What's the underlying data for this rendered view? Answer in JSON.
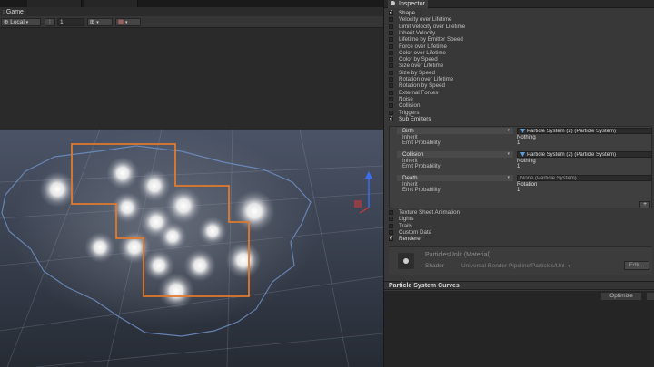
{
  "game_tab": {
    "label": "Game"
  },
  "toolbar": {
    "space_label": "Local",
    "number_value": "1"
  },
  "inspector": {
    "tab_label": "Inspector",
    "modules": [
      {
        "label": "Shape",
        "checked": true
      },
      {
        "label": "Velocity over Lifetime",
        "checked": false
      },
      {
        "label": "Limit Velocity over Lifetime",
        "checked": false
      },
      {
        "label": "Inherit Velocity",
        "checked": false
      },
      {
        "label": "Lifetime by Emitter Speed",
        "checked": false
      },
      {
        "label": "Force over Lifetime",
        "checked": false
      },
      {
        "label": "Color over Lifetime",
        "checked": false
      },
      {
        "label": "Color by Speed",
        "checked": false
      },
      {
        "label": "Size over Lifetime",
        "checked": false
      },
      {
        "label": "Size by Speed",
        "checked": false
      },
      {
        "label": "Rotation over Lifetime",
        "checked": false
      },
      {
        "label": "Rotation by Speed",
        "checked": false
      },
      {
        "label": "External Forces",
        "checked": false
      },
      {
        "label": "Noise",
        "checked": false
      },
      {
        "label": "Collision",
        "checked": false
      },
      {
        "label": "Triggers",
        "checked": false
      },
      {
        "label": "Sub Emitters",
        "checked": true
      }
    ],
    "sub_emitters": [
      {
        "type": "Birth",
        "target": "Particle System (2) (Particle System)",
        "inherit_label": "Inherit",
        "inherit_value": "Nothing",
        "prob_label": "Emit Probability",
        "prob_value": "1"
      },
      {
        "type": "Collision",
        "target": "Particle System (2) (Particle System)",
        "inherit_label": "Inherit",
        "inherit_value": "Nothing",
        "prob_label": "Emit Probability",
        "prob_value": "1"
      },
      {
        "type": "Death",
        "target": "None (Particle System)",
        "inherit_label": "Inherit",
        "inherit_value": "Rotation",
        "prob_label": "Emit Probability",
        "prob_value": "1"
      }
    ],
    "add_label": "+",
    "modules_after": [
      {
        "label": "Texture Sheet Animation",
        "checked": false
      },
      {
        "label": "Lights",
        "checked": false
      },
      {
        "label": "Trails",
        "checked": false
      },
      {
        "label": "Custom Data",
        "checked": false
      },
      {
        "label": "Renderer",
        "checked": true
      }
    ],
    "material": {
      "name": "ParticlesUnlit (Material)",
      "shader_label": "Shader",
      "shader_value": "Universal Render Pipeline/Particles/Unl",
      "edit_label": "Edit..."
    },
    "curves": {
      "title": "Particle System Curves",
      "optimize_label": "Optimize"
    }
  },
  "colors": {
    "selection_outline": "#e07a2e",
    "bounds_outline": "#6f8fc4",
    "grid_line": "#9aa3b3",
    "gizmo_blue": "#3a6ef0",
    "gizmo_red": "#c83a3a"
  }
}
